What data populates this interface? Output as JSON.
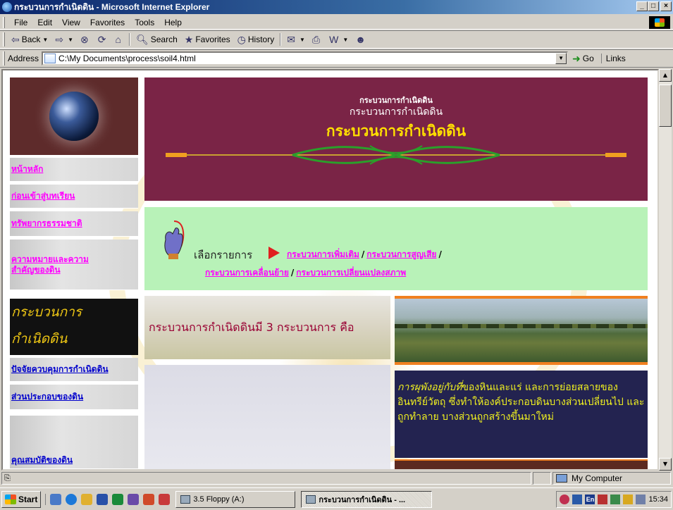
{
  "window": {
    "title": "กระบวนการกำเนิดดิน - Microsoft Internet Explorer",
    "buttons": {
      "minimize": "_",
      "maximize": "□",
      "close": "×"
    }
  },
  "menubar": {
    "items": [
      {
        "label": "File"
      },
      {
        "label": "Edit"
      },
      {
        "label": "View"
      },
      {
        "label": "Favorites"
      },
      {
        "label": "Tools"
      },
      {
        "label": "Help"
      }
    ]
  },
  "toolbar": {
    "back_label": "Back",
    "search_label": "Search",
    "favorites_label": "Favorites",
    "history_label": "History"
  },
  "address": {
    "label": "Address",
    "value": "C:\\My Documents\\process\\soil4.html",
    "go_label": "Go",
    "links_label": "Links"
  },
  "page": {
    "banner": {
      "line1": "กระบวนการกำเนิดดิน",
      "line2": "กระบวนการกำเนิดดิน",
      "line3": "กระบวนการกำเนิดดิน"
    },
    "nav": [
      {
        "label": "หน้าหลัก"
      },
      {
        "label": "ก่อนเข้าสู่บทเรียน"
      },
      {
        "label": "ทรัพยากรธรรมชาติ"
      },
      {
        "label": "ความหมายและความสำคัญของดิน"
      }
    ],
    "current_section": {
      "line1": "กระบวนการ",
      "line2": "กำเนิดดิน"
    },
    "nav_more": [
      {
        "label": "ปัจจัยควบคุมการกำเนิดดิน"
      },
      {
        "label": "ส่วนประกอบของดิน"
      },
      {
        "label": "คุณสมบัติของดิน"
      }
    ],
    "choose_label": "เลือกรายการ",
    "process_links": [
      {
        "label": "กระบวนการเพิ่มเติม"
      },
      {
        "label": "กระบวนการสูญเสีย"
      },
      {
        "label": "กระบวนการเคลื่อนย้าย"
      },
      {
        "label": "กระบวนการเปลี่ยนแปลงสภาพ"
      }
    ],
    "intro": "กระบวนการกำเนิดดินมี 3 กระบวนการ คือ",
    "description": {
      "italic": "การผุพังอยู่กับที่",
      "rest": "ของหินและแร่ และการย่อยสลายของอินทรีย์วัตถุ ซึ่งทำให้องค์ประกอบดินบางส่วนเปลี่ยนไป และถูกทำลาย บางส่วนถูกสร้างขึ้นมาใหม่"
    }
  },
  "statusbar": {
    "zone": "My Computer"
  },
  "taskbar": {
    "start_label": "Start",
    "tasks": [
      {
        "label": "3.5 Floppy (A:)"
      },
      {
        "label": "กระบวนการกำเนิดดิน - ..."
      }
    ],
    "tray_lang": "En",
    "clock": "15:34"
  }
}
